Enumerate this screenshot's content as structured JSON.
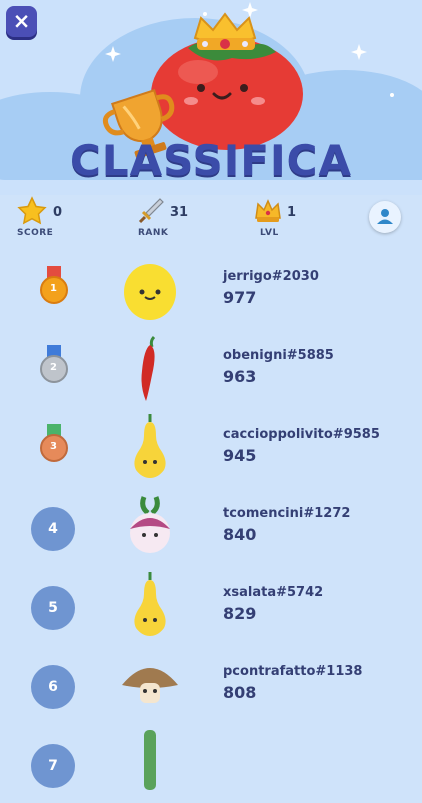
{
  "header": {
    "title": "CLASSIFICA",
    "close_icon": "×"
  },
  "stats": [
    {
      "label": "SCORE",
      "value": "0",
      "icon": "star-icon"
    },
    {
      "label": "RANK",
      "value": "31",
      "icon": "sword-icon"
    },
    {
      "label": "LVL",
      "value": "1",
      "icon": "crown-icon"
    }
  ],
  "leaderboard": [
    {
      "rank": "1",
      "user": "jerrigo#2030",
      "score": "977",
      "veg": "lemon",
      "medal": "gold"
    },
    {
      "rank": "2",
      "user": "obenigni#5885",
      "score": "963",
      "veg": "chili",
      "medal": "silver"
    },
    {
      "rank": "3",
      "user": "caccioppolivito#9585",
      "score": "945",
      "veg": "squash",
      "medal": "bronze"
    },
    {
      "rank": "4",
      "user": "tcomencini#1272",
      "score": "840",
      "veg": "turnip"
    },
    {
      "rank": "5",
      "user": "xsalata#5742",
      "score": "829",
      "veg": "squash"
    },
    {
      "rank": "6",
      "user": "pcontrafatto#1138",
      "score": "808",
      "veg": "mushroom"
    },
    {
      "rank": "7",
      "user": "",
      "score": "",
      "veg": "leek"
    }
  ],
  "colors": {
    "background": "#cfe3fa",
    "title": "#3b4ca9",
    "rank_circle": "#6f95d1",
    "text": "#343f74"
  }
}
